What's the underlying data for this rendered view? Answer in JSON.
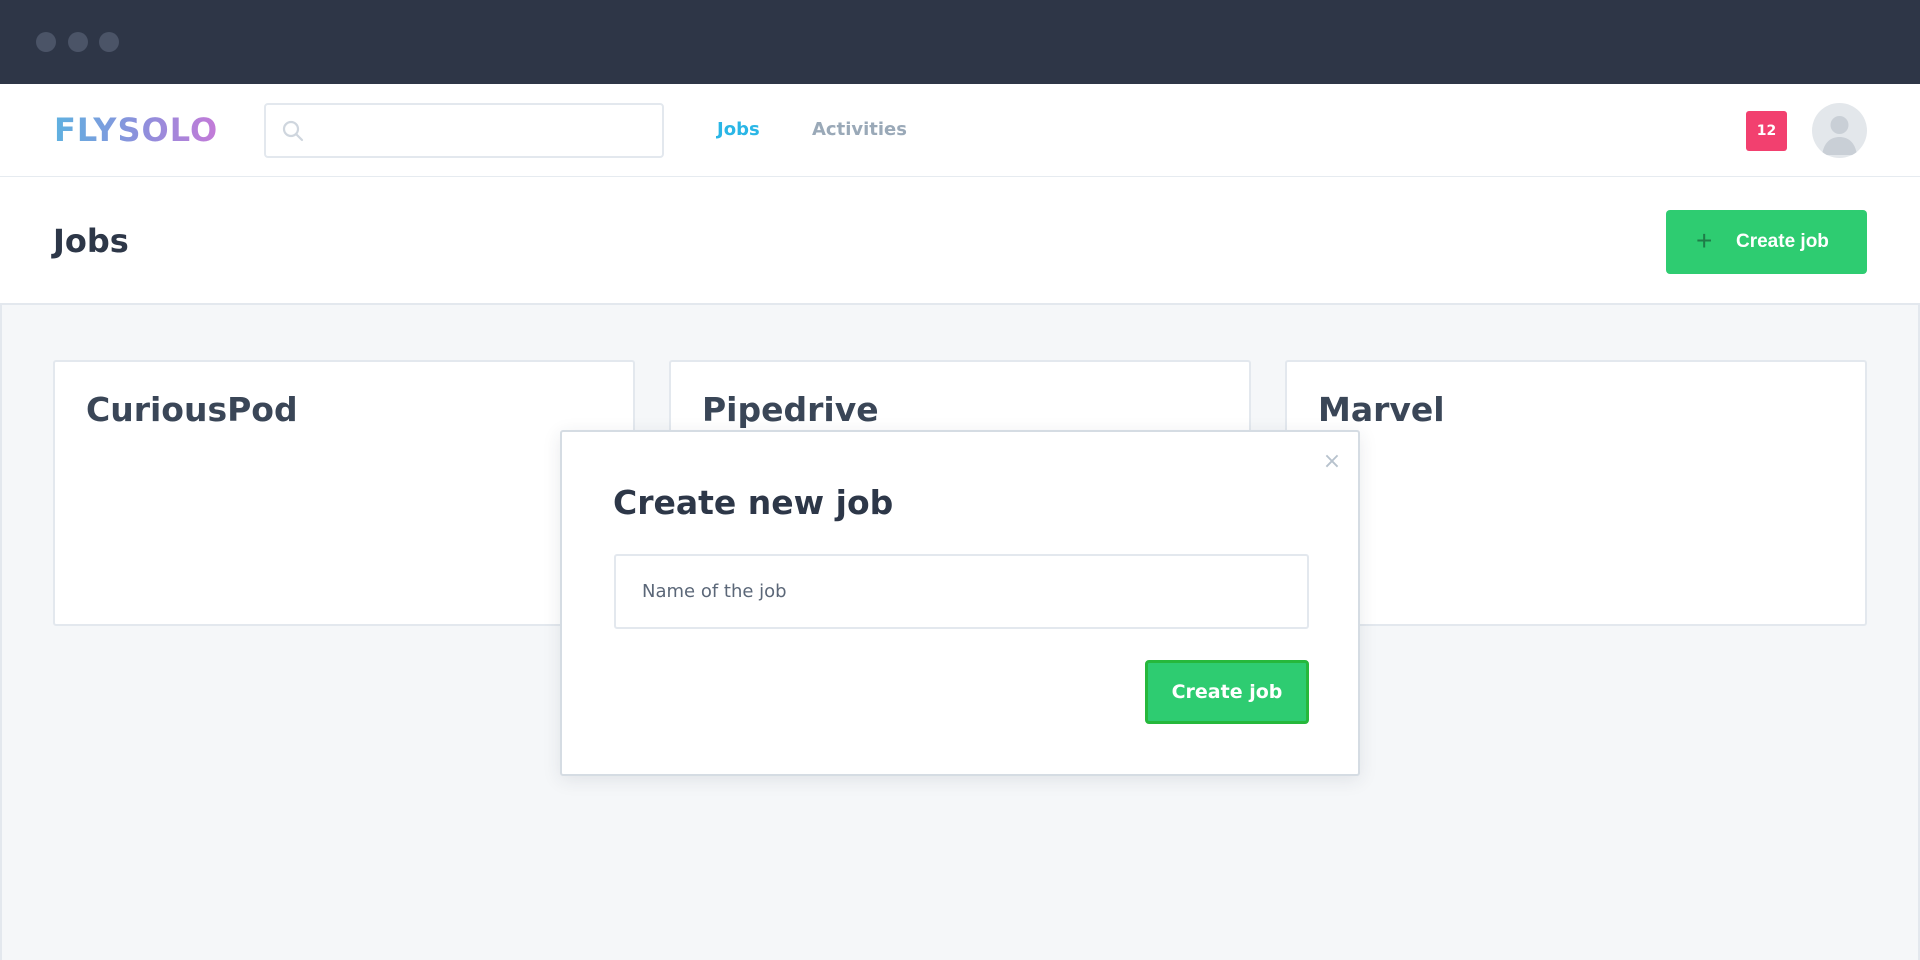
{
  "nav": {
    "logo": "FLYSOLO",
    "search_placeholder": "",
    "links": [
      {
        "label": "Jobs",
        "active": true
      },
      {
        "label": "Activities",
        "active": false
      }
    ],
    "notification_count": "12",
    "avatar_icon": "user-silhouette-icon"
  },
  "header": {
    "title": "Jobs",
    "create_button": {
      "icon": "plus-icon",
      "label": "Create job"
    }
  },
  "jobs": [
    {
      "name": "CuriousPod"
    },
    {
      "name": "Pipedrive"
    },
    {
      "name": "Marvel"
    }
  ],
  "modal": {
    "title": "Create new job",
    "close_icon": "close-icon",
    "input_placeholder": "Name of the job",
    "input_value": "",
    "submit_label": "Create job"
  },
  "colors": {
    "accent_green": "#2ecc71",
    "active_link": "#2ab6e6",
    "badge": "#f2406f",
    "window_bar": "#2e3647"
  }
}
